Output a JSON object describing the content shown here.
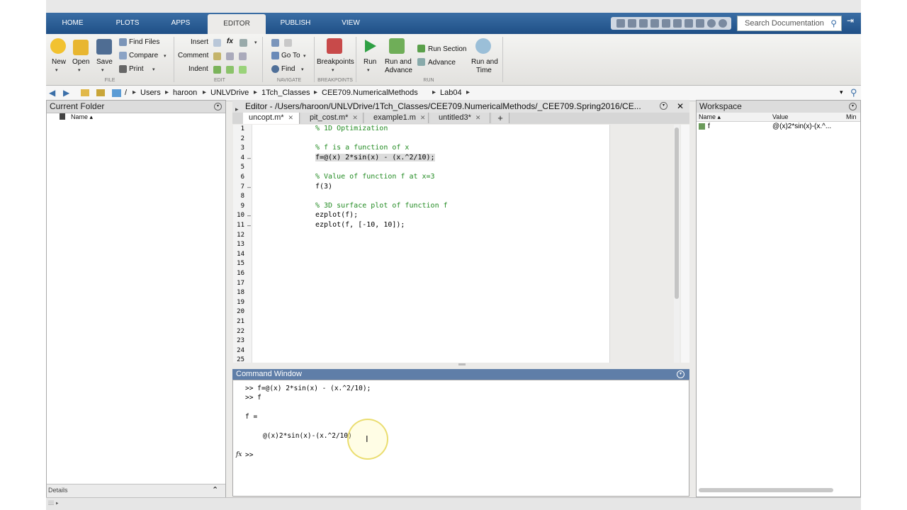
{
  "tabs": [
    "HOME",
    "PLOTS",
    "APPS",
    "EDITOR",
    "PUBLISH",
    "VIEW"
  ],
  "active_tab": "EDITOR",
  "search": {
    "placeholder": "Search Documentation"
  },
  "ribbon": {
    "file": {
      "new": "New",
      "open": "Open",
      "save": "Save",
      "find_files": "Find Files",
      "compare": "Compare",
      "print": "Print",
      "group": "FILE"
    },
    "edit": {
      "insert": "Insert",
      "comment": "Comment",
      "indent": "Indent",
      "fx": "fx",
      "group": "EDIT"
    },
    "navigate": {
      "go_to": "Go To",
      "find": "Find",
      "group": "NAVIGATE"
    },
    "breakpoints": {
      "label": "Breakpoints",
      "group": "BREAKPOINTS"
    },
    "run": {
      "run": "Run",
      "run_and_advance_1": "Run and",
      "run_and_advance_2": "Advance",
      "run_section": "Run Section",
      "advance": "Advance",
      "run_and_time_1": "Run and",
      "run_and_time_2": "Time",
      "group": "RUN"
    }
  },
  "address": {
    "root": "/",
    "parts": [
      "Users",
      "haroon",
      "UNLVDrive",
      "1Tch_Classes",
      "CEE709.NumericalMethods",
      "Lab04"
    ]
  },
  "current_folder": {
    "title": "Current Folder",
    "col_name": "Name ▴",
    "details": "Details"
  },
  "editor": {
    "title": "Editor - /Users/haroon/UNLVDrive/1Tch_Classes/CEE709.NumericalMethods/_CEE709.Spring2016/CE...",
    "tabs": [
      "uncopt.m*",
      "pit_cost.m*",
      "example1.m",
      "untitled3*"
    ],
    "lines": [
      {
        "n": "1",
        "text": "% 1D Optimization",
        "comment": true
      },
      {
        "n": "2",
        "text": ""
      },
      {
        "n": "3",
        "text": "% f is a function of x",
        "comment": true
      },
      {
        "n": "4",
        "text": "f=@(x) 2*sin(x) - (x.^2/10);",
        "dash": true,
        "hl": true
      },
      {
        "n": "5",
        "text": ""
      },
      {
        "n": "6",
        "text": "% Value of function f at x=3",
        "comment": true
      },
      {
        "n": "7",
        "text": "f(3)",
        "dash": true
      },
      {
        "n": "8",
        "text": ""
      },
      {
        "n": "9",
        "text": "% 3D surface plot of function f",
        "comment": true
      },
      {
        "n": "10",
        "text": "ezplot(f);",
        "dash": true
      },
      {
        "n": "11",
        "text": "ezplot(f, [-10, 10]);",
        "dash": true
      },
      {
        "n": "12",
        "text": ""
      },
      {
        "n": "13",
        "text": ""
      },
      {
        "n": "14",
        "text": ""
      },
      {
        "n": "15",
        "text": ""
      },
      {
        "n": "16",
        "text": ""
      },
      {
        "n": "17",
        "text": ""
      },
      {
        "n": "18",
        "text": ""
      },
      {
        "n": "19",
        "text": ""
      },
      {
        "n": "20",
        "text": ""
      },
      {
        "n": "21",
        "text": ""
      },
      {
        "n": "22",
        "text": ""
      },
      {
        "n": "23",
        "text": ""
      },
      {
        "n": "24",
        "text": ""
      },
      {
        "n": "25",
        "text": ""
      }
    ]
  },
  "command_window": {
    "title": "Command Window",
    "lines": [
      ">> f=@(x) 2*sin(x) - (x.^2/10);",
      ">> f",
      "f =",
      "@(x)2*sin(x)-(x.^2/10)",
      ">>"
    ],
    "fx": "fx"
  },
  "workspace": {
    "title": "Workspace",
    "col_name": "Name ▴",
    "col_value": "Value",
    "col_min": "Min",
    "var_name": "f",
    "var_value": "@(x)2*sin(x)-(x.^..."
  }
}
